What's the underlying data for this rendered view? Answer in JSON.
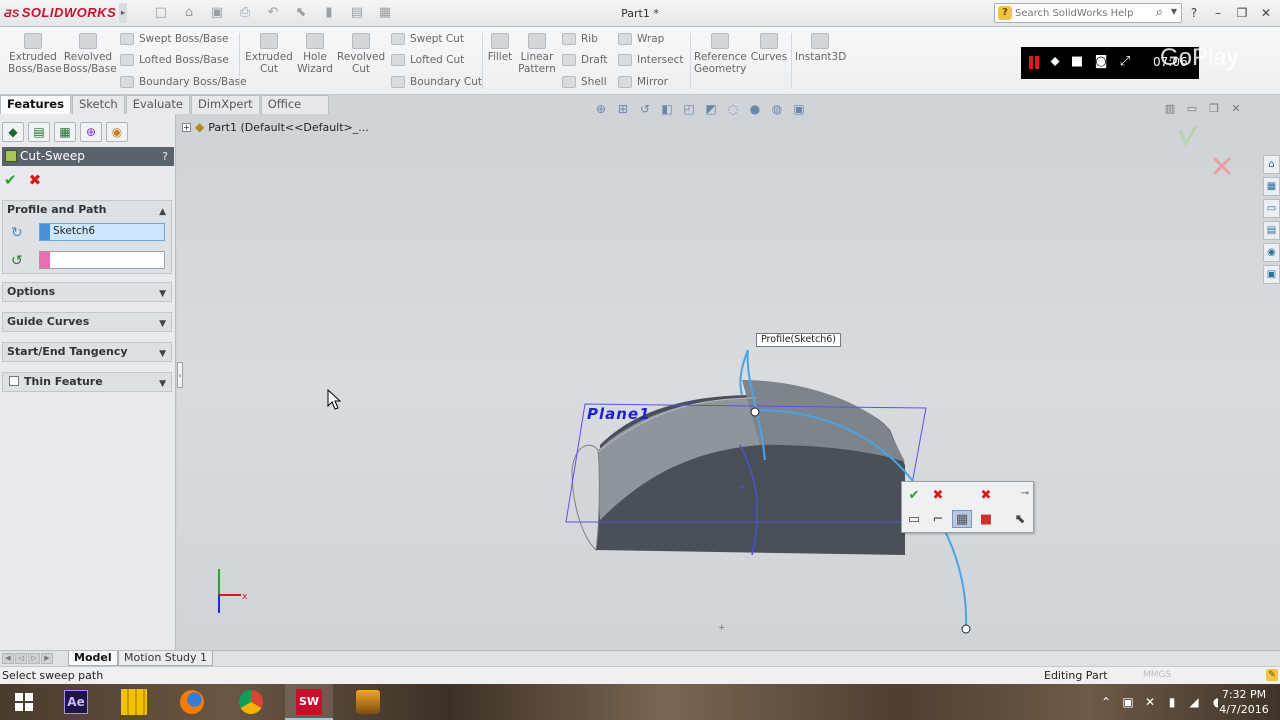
{
  "app": {
    "logo_text": "SOLIDWORKS",
    "document_title": "Part1 *"
  },
  "search": {
    "placeholder": "Search SolidWorks Help"
  },
  "command_manager": {
    "extruded_boss": "Extruded\nBoss/Base",
    "revolved_boss": "Revolved\nBoss/Base",
    "swept_boss": "Swept Boss/Base",
    "lofted_boss": "Lofted Boss/Base",
    "boundary_boss": "Boundary Boss/Base",
    "extruded_cut": "Extruded\nCut",
    "hole_wizard": "Hole\nWizard",
    "revolved_cut": "Revolved\nCut",
    "swept_cut": "Swept Cut",
    "lofted_cut": "Lofted Cut",
    "boundary_cut": "Boundary Cut",
    "fillet": "Fillet",
    "linear_pattern": "Linear\nPattern",
    "rib": "Rib",
    "draft": "Draft",
    "shell": "Shell",
    "wrap": "Wrap",
    "intersect": "Intersect",
    "mirror": "Mirror",
    "reference_geometry": "Reference\nGeometry",
    "curves": "Curves",
    "instant3d": "Instant3D"
  },
  "video_overlay": {
    "time": "07:06",
    "brand": "GoPlay"
  },
  "tabs": [
    {
      "label": "Features"
    },
    {
      "label": "Sketch"
    },
    {
      "label": "Evaluate"
    },
    {
      "label": "DimXpert"
    },
    {
      "label": "Office Products"
    }
  ],
  "tree": {
    "part_label": "Part1  (Default<<Default>_..."
  },
  "property_manager": {
    "title": "Cut-Sweep",
    "help": "?",
    "groups": {
      "profile_path": "Profile and Path",
      "options": "Options",
      "guide_curves": "Guide Curves",
      "tangency": "Start/End Tangency",
      "thin_feature": "Thin Feature"
    },
    "profile_value": "Sketch6",
    "path_value": "",
    "profile_color": "#4a90d9",
    "path_color": "#e86fb0"
  },
  "graphics": {
    "callout": "Profile(Sketch6)",
    "plane_label": "Plane1"
  },
  "bottom_tabs": [
    {
      "label": "Model"
    },
    {
      "label": "Motion Study 1"
    }
  ],
  "status": {
    "left": "Select sweep path",
    "right": "Editing Part",
    "units": "MMGS"
  },
  "taskbar": {
    "time": "7:32 PM",
    "date": "4/7/2016"
  },
  "colors": {
    "accent": "#c8102e",
    "pm_header": "#5a626b",
    "sketch_blue": "#4aa3e6",
    "plane_blue": "#2020d0"
  }
}
